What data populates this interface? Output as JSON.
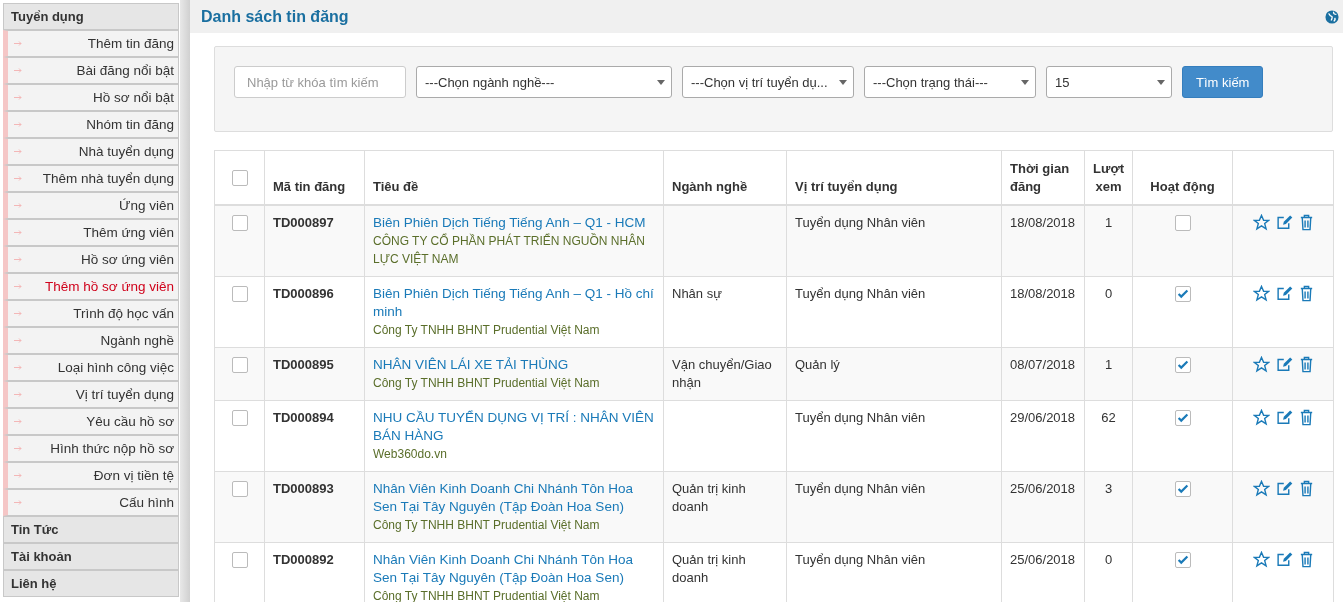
{
  "sidebar": {
    "groups": [
      {
        "title": "Tuyển dụng",
        "items": [
          {
            "label": "Thêm tin đăng",
            "selected": false
          },
          {
            "label": "Bài đăng nổi bật",
            "selected": false
          },
          {
            "label": "Hồ sơ nổi bật",
            "selected": false
          },
          {
            "label": "Nhóm tin đăng",
            "selected": false
          },
          {
            "label": "Nhà tuyển dụng",
            "selected": false
          },
          {
            "label": "Thêm nhà tuyển dụng",
            "selected": false
          },
          {
            "label": "Ứng viên",
            "selected": false
          },
          {
            "label": "Thêm ứng viên",
            "selected": false
          },
          {
            "label": "Hồ sơ ứng viên",
            "selected": false
          },
          {
            "label": "Thêm hồ sơ ứng viên",
            "selected": true
          },
          {
            "label": "Trình độ học vấn",
            "selected": false
          },
          {
            "label": "Ngành nghề",
            "selected": false
          },
          {
            "label": "Loại hình công việc",
            "selected": false
          },
          {
            "label": "Vị trí tuyển dụng",
            "selected": false
          },
          {
            "label": "Yêu cầu hồ sơ",
            "selected": false
          },
          {
            "label": "Hình thức nộp hồ sơ",
            "selected": false
          },
          {
            "label": "Đơn vị tiền tệ",
            "selected": false
          },
          {
            "label": "Cấu hình",
            "selected": false
          }
        ]
      },
      {
        "title": "Tin Tức"
      },
      {
        "title": "Tài khoản"
      },
      {
        "title": "Liên hệ"
      }
    ]
  },
  "page": {
    "title": "Danh sách tin đăng"
  },
  "filters": {
    "search": {
      "placeholder": "Nhập từ khóa tìm kiếm"
    },
    "selects": [
      {
        "value": "---Chọn ngành nghề---"
      },
      {
        "value": "---Chọn vị trí tuyển dụ..."
      },
      {
        "value": "---Chọn trạng thái---"
      },
      {
        "value": "15"
      }
    ],
    "button": "Tìm kiếm"
  },
  "table": {
    "columns": [
      "Mã tin đăng",
      "Tiêu đề",
      "Ngành nghề",
      "Vị trí tuyển dụng",
      "Thời gian đăng",
      "Lượt xem",
      "Hoạt động"
    ],
    "select_all": {
      "checked": false
    },
    "rows": [
      {
        "checked": false,
        "code": "TD000897",
        "title": "Biên Phiên Dịch Tiếng Tiếng Anh – Q1 - HCM",
        "company": "CÔNG TY CỔ PHẦN PHÁT TRIỂN NGUỒN NHÂN LỰC VIỆT NAM",
        "industry": "",
        "position": "Tuyển dụng Nhân viên",
        "date": "18/08/2018",
        "views": "1",
        "active": false
      },
      {
        "checked": false,
        "code": "TD000896",
        "title": "Biên Phiên Dịch Tiếng Tiếng Anh – Q1 - Hồ chí minh",
        "company": "Công Ty TNHH BHNT Prudential Việt Nam",
        "industry": "Nhân sự",
        "position": "Tuyển dụng Nhân viên",
        "date": "18/08/2018",
        "views": "0",
        "active": true
      },
      {
        "checked": false,
        "code": "TD000895",
        "title": "NHÂN VIÊN LÁI XE TẢI THÙNG",
        "company": "Công Ty TNHH BHNT Prudential Việt Nam",
        "industry": "Vận chuyển/Giao nhận",
        "position": "Quản lý",
        "date": "08/07/2018",
        "views": "1",
        "active": true
      },
      {
        "checked": false,
        "code": "TD000894",
        "title": "NHU CẦU TUYỂN DỤNG VỊ TRÍ : NHÂN VIÊN BÁN HÀNG",
        "company": "Web360do.vn",
        "industry": "",
        "position": "Tuyển dụng Nhân viên",
        "date": "29/06/2018",
        "views": "62",
        "active": true
      },
      {
        "checked": false,
        "code": "TD000893",
        "title": "Nhân Viên Kinh Doanh Chi Nhánh Tôn Hoa Sen Tại Tây Nguyên (Tập Đoàn Hoa Sen)",
        "company": "Công Ty TNHH BHNT Prudential Việt Nam",
        "industry": "Quản trị kinh doanh",
        "position": "Tuyển dụng Nhân viên",
        "date": "25/06/2018",
        "views": "3",
        "active": true
      },
      {
        "checked": false,
        "code": "TD000892",
        "title": "Nhân Viên Kinh Doanh Chi Nhánh Tôn Hoa Sen Tại Tây Nguyên (Tập Đoàn Hoa Sen)",
        "company": "Công Ty TNHH BHNT Prudential Việt Nam",
        "industry": "Quản trị kinh doanh",
        "position": "Tuyển dụng Nhân viên",
        "date": "25/06/2018",
        "views": "0",
        "active": true
      }
    ]
  }
}
